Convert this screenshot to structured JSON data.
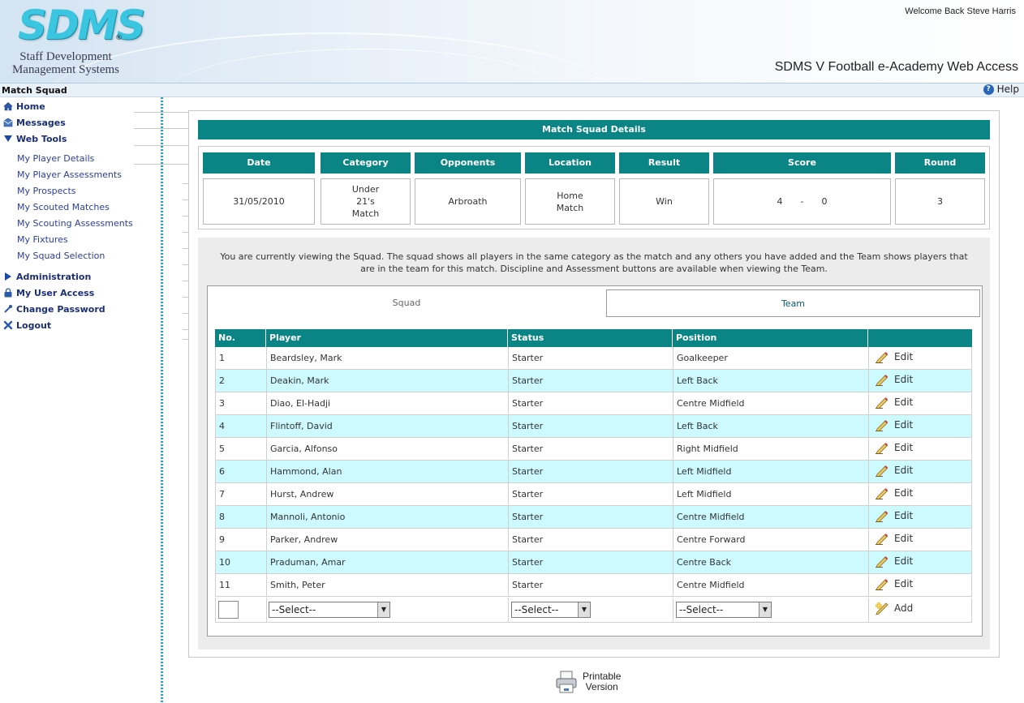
{
  "header": {
    "logo_text": "SDMS",
    "logo_reg": "®",
    "logo_sub_1": "Staff Development",
    "logo_sub_2": "Management Systems",
    "welcome": "Welcome Back Steve Harris",
    "app_title": "SDMS V Football e-Academy Web Access"
  },
  "titlebar": {
    "page_name": "Match Squad",
    "help_label": "Help"
  },
  "sidebar": {
    "nav": [
      {
        "label": "Home",
        "icon": "home-icon"
      },
      {
        "label": "Messages",
        "icon": "messages-icon"
      },
      {
        "label": "Web Tools",
        "icon": "expanded-triangle-icon"
      }
    ],
    "web_tools": [
      "My Player Details",
      "My Player Assessments",
      "My Prospects",
      "My Scouted Matches",
      "My Scouting Assessments",
      "My Fixtures",
      "My Squad Selection"
    ],
    "nav2": [
      {
        "label": "Administration",
        "icon": "collapsed-triangle-icon"
      },
      {
        "label": "My User Access",
        "icon": "lock-icon"
      },
      {
        "label": "Change Password",
        "icon": "key-icon"
      },
      {
        "label": "Logout",
        "icon": "logout-x-icon"
      }
    ]
  },
  "details": {
    "title": "Match Squad Details",
    "headers": [
      "Date",
      "Category",
      "Opponents",
      "Location",
      "Result",
      "Score",
      "Round"
    ],
    "values": {
      "date": "31/05/2010",
      "category_1": "Under",
      "category_2": "21's",
      "category_3": "Match",
      "opponents": "Arbroath",
      "location_1": "Home",
      "location_2": "Match",
      "result": "Win",
      "score_home": "4",
      "score_sep": "-",
      "score_away": "0",
      "round": "3"
    }
  },
  "info_text": "You are currently viewing the Squad. The squad shows all players in the same category as the match and any others you have added and the Team shows players that are in the team for this match. Discipline and Assessment buttons are available when viewing the Team.",
  "tabs": {
    "squad": "Squad",
    "team": "Team"
  },
  "table": {
    "headers": [
      "No.",
      "Player",
      "Status",
      "Position",
      ""
    ],
    "edit_label": "Edit",
    "rows": [
      {
        "no": "1",
        "player": "Beardsley, Mark",
        "status": "Starter",
        "position": "Goalkeeper"
      },
      {
        "no": "2",
        "player": "Deakin, Mark",
        "status": "Starter",
        "position": "Left Back"
      },
      {
        "no": "3",
        "player": "Diao, El-Hadji",
        "status": "Starter",
        "position": "Centre Midfield"
      },
      {
        "no": "4",
        "player": "Flintoff, David",
        "status": "Starter",
        "position": "Left Back"
      },
      {
        "no": "5",
        "player": "Garcia, Alfonso",
        "status": "Starter",
        "position": "Right Midfield"
      },
      {
        "no": "6",
        "player": "Hammond, Alan",
        "status": "Starter",
        "position": "Left Midfield"
      },
      {
        "no": "7",
        "player": "Hurst, Andrew",
        "status": "Starter",
        "position": "Left Midfield"
      },
      {
        "no": "8",
        "player": "Mannoli, Antonio",
        "status": "Starter",
        "position": "Centre Midfield"
      },
      {
        "no": "9",
        "player": "Parker, Andrew",
        "status": "Starter",
        "position": "Centre Forward"
      },
      {
        "no": "10",
        "player": "Praduman, Amar",
        "status": "Starter",
        "position": "Centre Back"
      },
      {
        "no": "11",
        "player": "Smith, Peter",
        "status": "Starter",
        "position": "Centre Midfield"
      }
    ],
    "add_row": {
      "player_select": "--Select--",
      "status_select": "--Select--",
      "position_select": "--Select--",
      "add_label": "Add"
    }
  },
  "printable": {
    "line1": "Printable",
    "line2": "Version"
  },
  "colors": {
    "teal": "#0a8484",
    "alt_row": "#ccfaff",
    "nav_blue": "#1a2e7a"
  }
}
